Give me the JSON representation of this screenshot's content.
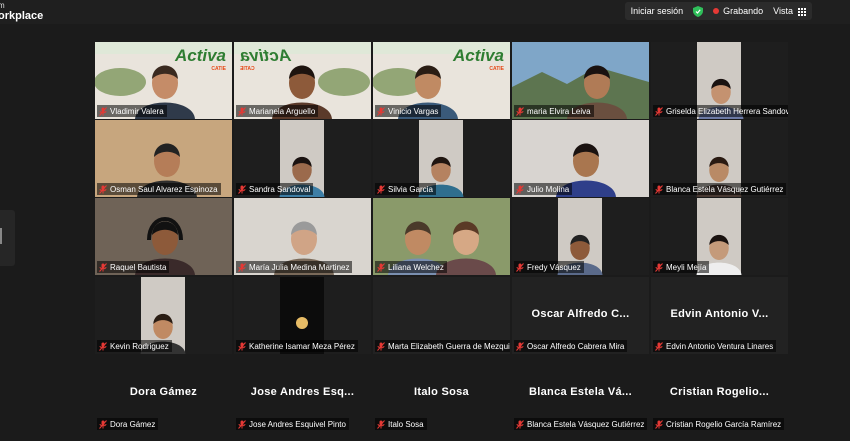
{
  "brand": {
    "line1": "m",
    "line2": "orkplace"
  },
  "topbar": {
    "leave": "Iniciar sesión",
    "recording": "Grabando",
    "view": "Vista"
  },
  "participants": [
    {
      "name": "Vladimir Valera"
    },
    {
      "name": "Marianela Arguello"
    },
    {
      "name": "Vinicio Vargas"
    },
    {
      "name": "maria Elvira Leiva"
    },
    {
      "name": "Griselda Elizabeth Herrera Sandoval"
    },
    {
      "name": "Osman Saul Alvarez Espinoza"
    },
    {
      "name": "Sandra Sandoval"
    },
    {
      "name": "Silvia Garcia"
    },
    {
      "name": "Julio Molina"
    },
    {
      "name": "Blanca Estela Vásquez Gutiérrez"
    },
    {
      "name": "Raquel Bautista"
    },
    {
      "name": "María Julia Medina Martinez"
    },
    {
      "name": "Liliana Welchez"
    },
    {
      "name": "Fredy Vásquez"
    },
    {
      "name": "Meyli Mejía"
    },
    {
      "name": "Kevin Rodriguez"
    },
    {
      "name": "Katherine Isamar Meza Pérez"
    },
    {
      "name": "Marta Elizabeth Guerra de Mezquita"
    },
    {
      "name": "Oscar Alfredo Cabrera Mira",
      "display": "Oscar Alfredo C..."
    },
    {
      "name": "Edvin Antonio Ventura Linares",
      "display": "Edvin Antonio V..."
    },
    {
      "name": "Dora Gámez",
      "display": "Dora Gámez"
    },
    {
      "name": "Jose Andres Esquivel Pinto",
      "display": "Jose Andres Esq..."
    },
    {
      "name": "Italo Sosa",
      "display": "Italo Sosa"
    },
    {
      "name": "Blanca Estela Vásquez Gutiérrez",
      "display": "Blanca Estela Vá..."
    },
    {
      "name": "Cristian Rogelio García Ramírez",
      "display": "Cristian Rogelio..."
    }
  ],
  "logos": {
    "text": "Activa",
    "sub": "CATIE"
  },
  "colors": {
    "active_speaker": "#2fbf5a",
    "muted_mic": "#e53935"
  }
}
